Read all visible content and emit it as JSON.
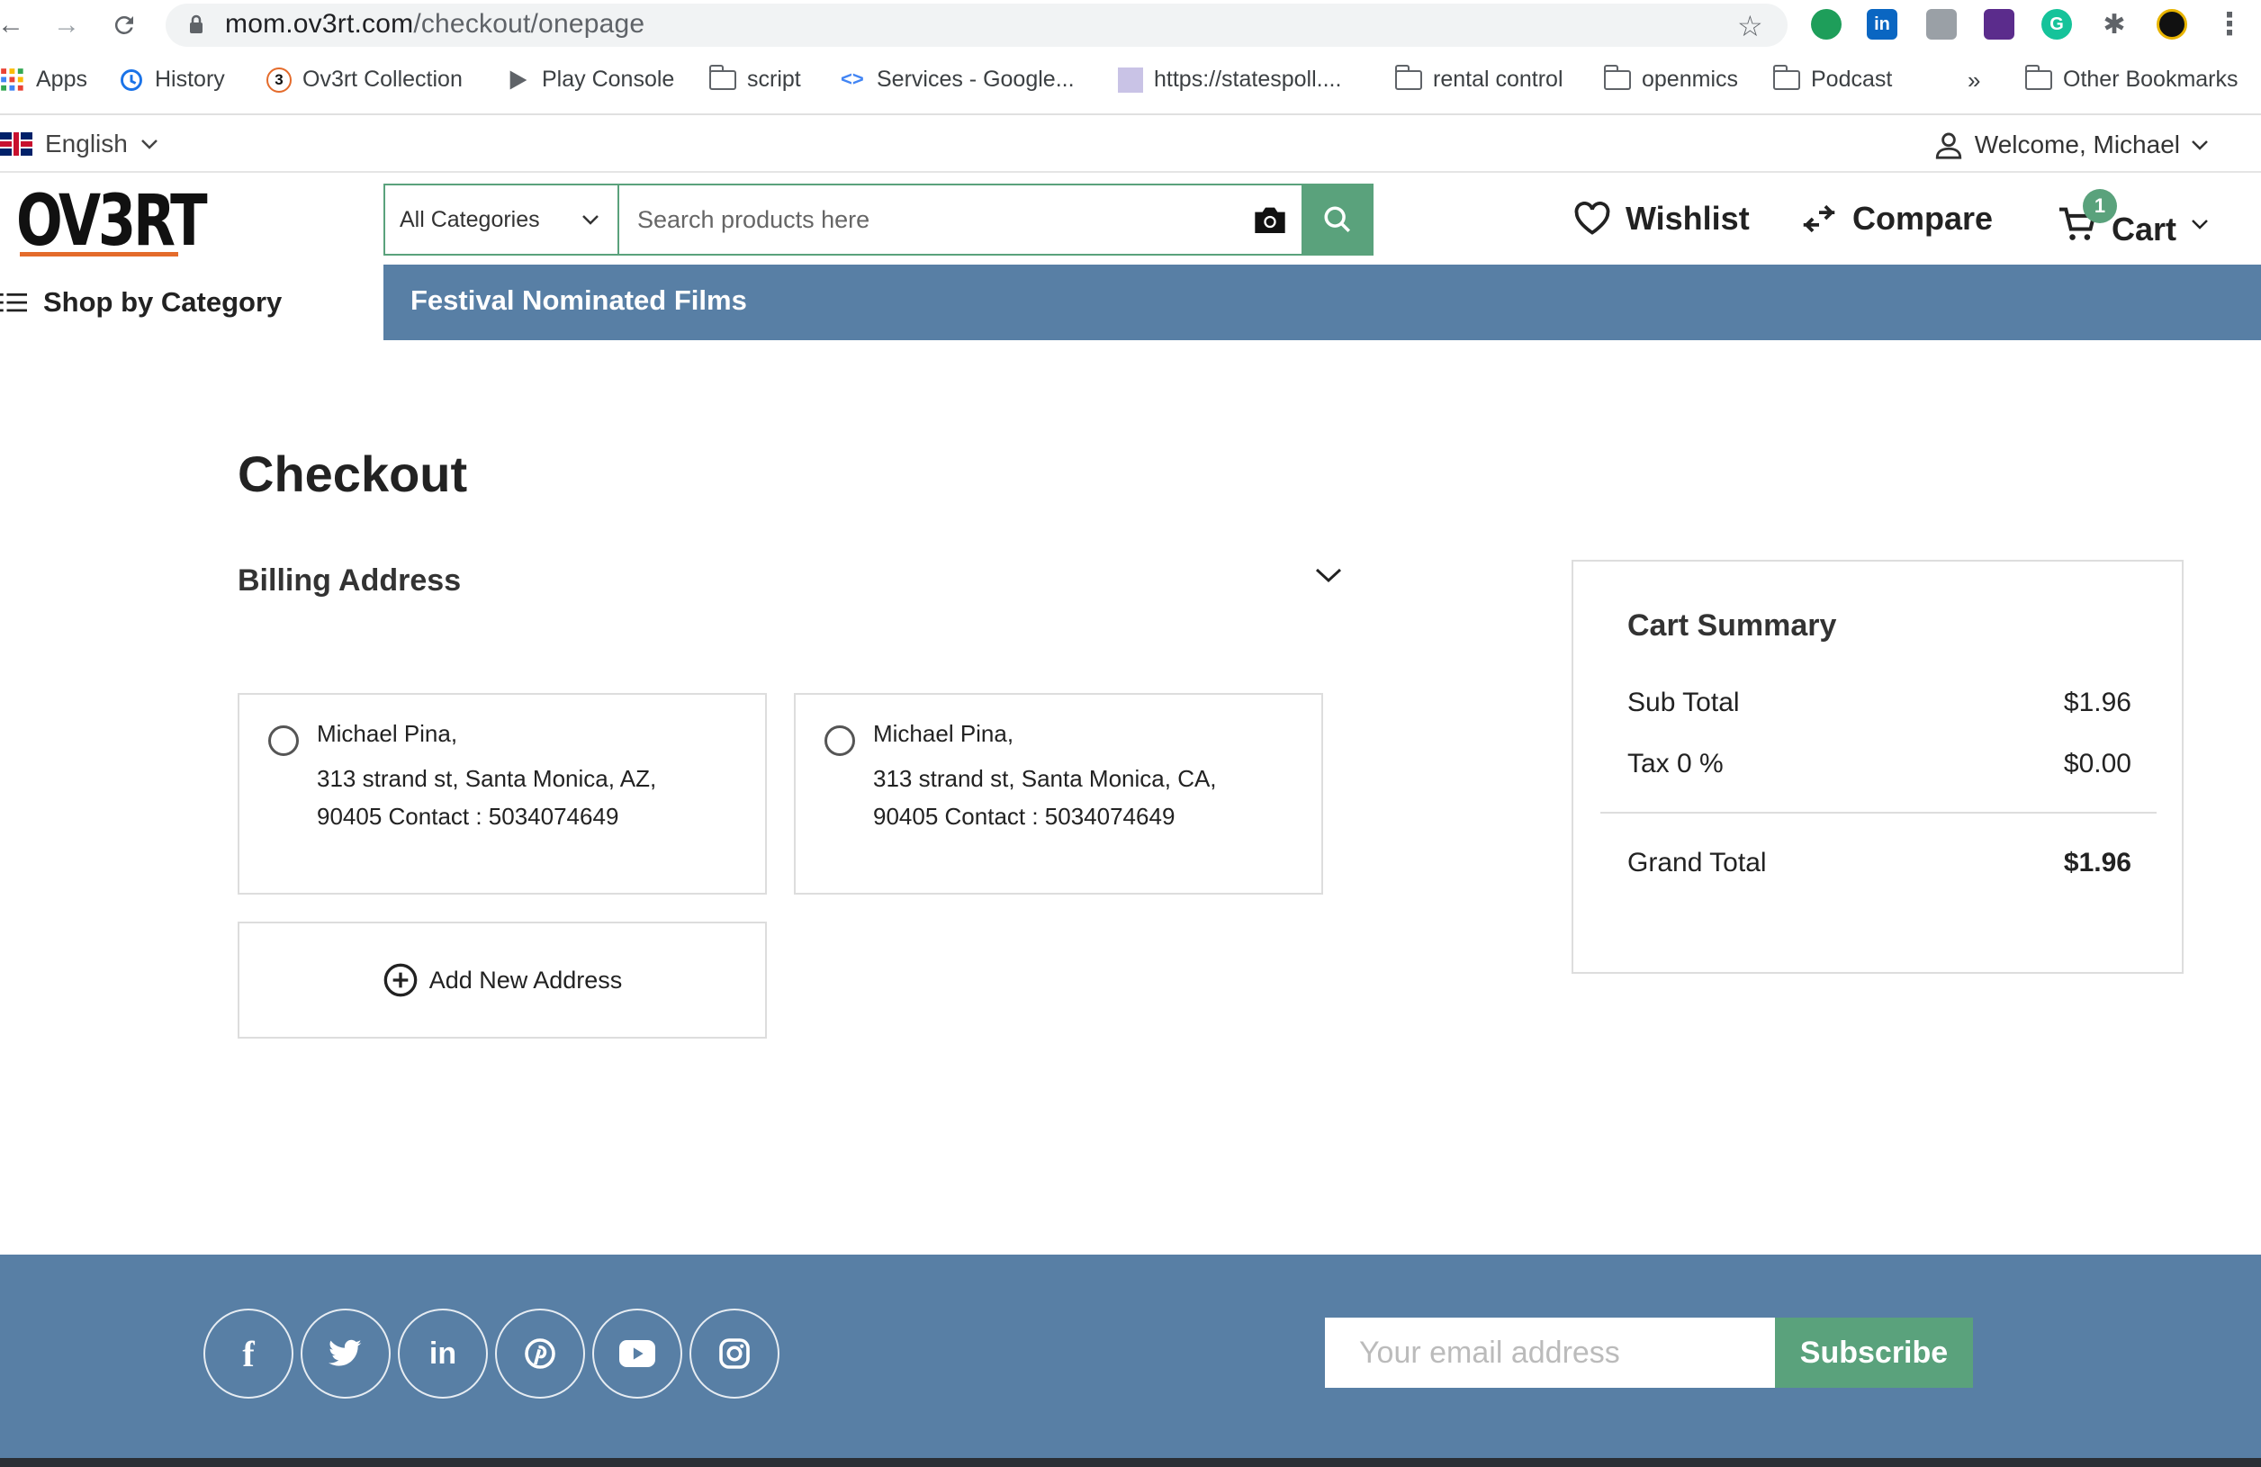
{
  "browser": {
    "url_host": "mom.ov3rt.com",
    "url_path": "/checkout/onepage",
    "bookmarks": [
      {
        "label": "Apps"
      },
      {
        "label": "History"
      },
      {
        "label": "Ov3rt Collection"
      },
      {
        "label": "Play Console"
      },
      {
        "label": "script"
      },
      {
        "label": "Services - Google..."
      },
      {
        "label": "https://statespoll...."
      },
      {
        "label": "rental control"
      },
      {
        "label": "openmics"
      },
      {
        "label": "Podcast"
      },
      {
        "label": "Other Bookmarks"
      }
    ],
    "overflow_label": "»"
  },
  "topstrip": {
    "language": "English",
    "welcome": "Welcome, Michael"
  },
  "header": {
    "logo_text": "OV3RT",
    "category_select": "All Categories",
    "search_placeholder": "Search products here",
    "wishlist": "Wishlist",
    "compare": "Compare",
    "cart": "Cart",
    "cart_count": "1"
  },
  "nav": {
    "shop_by_category": "Shop by Category",
    "links": [
      {
        "label": "Festival Nominated Films"
      }
    ]
  },
  "checkout": {
    "title": "Checkout",
    "billing_title": "Billing Address",
    "addresses": [
      {
        "name": "Michael Pina,",
        "line1": "313 strand st, Santa Monica, AZ,",
        "line2": "90405 Contact : 5034074649"
      },
      {
        "name": "Michael Pina,",
        "line1": "313 strand st, Santa Monica, CA,",
        "line2": "90405 Contact : 5034074649"
      }
    ],
    "add_new": "Add New Address"
  },
  "summary": {
    "title": "Cart Summary",
    "sub_total_label": "Sub Total",
    "sub_total": "$1.96",
    "tax_label": "Tax 0 %",
    "tax": "$0.00",
    "grand_total_label": "Grand Total",
    "grand_total": "$1.96"
  },
  "footer": {
    "social": [
      {
        "icon": "facebook-icon",
        "glyph": "f"
      },
      {
        "icon": "twitter-icon",
        "glyph": ""
      },
      {
        "icon": "linkedin-icon",
        "glyph": "in"
      },
      {
        "icon": "pinterest-icon",
        "glyph": ""
      },
      {
        "icon": "youtube-icon",
        "glyph": ""
      },
      {
        "icon": "instagram-icon",
        "glyph": ""
      }
    ],
    "email_placeholder": "Your email address",
    "subscribe": "Subscribe"
  },
  "colors": {
    "accent_green": "#5aa27c",
    "nav_blue": "#587fa5",
    "logo_underline": "#e46b2b"
  }
}
